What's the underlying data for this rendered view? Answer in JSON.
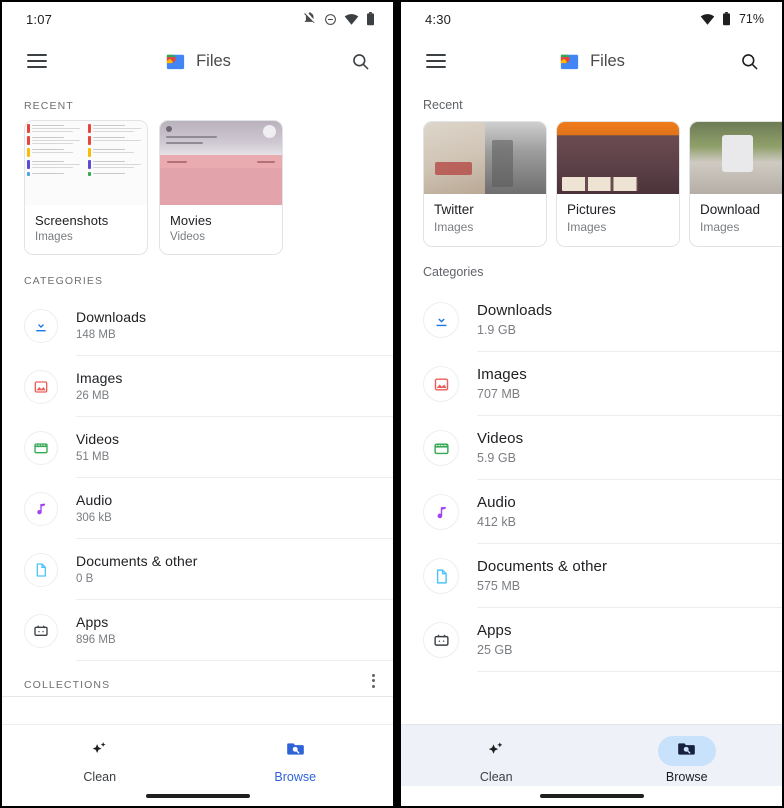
{
  "app": {
    "name": "Files",
    "brand_blue": "#4285f4",
    "accent_blue": "#2f63d8",
    "chip_blue": "#c8e2fb"
  },
  "left_phone": {
    "status": {
      "time": "1:07",
      "icons": [
        "notifications-off-icon",
        "do-not-disturb-icon",
        "wifi-icon",
        "battery-icon"
      ]
    },
    "appbar": {
      "menu": "menu-icon",
      "title": "Files",
      "search": "search-icon"
    },
    "recent": {
      "heading": "RECENT",
      "cards": [
        {
          "title": "Screenshots",
          "subtitle": "Images",
          "thumb": "screenshot-collage"
        },
        {
          "title": "Movies",
          "subtitle": "Videos",
          "thumb": "movie-player"
        }
      ]
    },
    "categories": {
      "heading": "CATEGORIES",
      "items": [
        {
          "icon": "download-icon",
          "color": "#1a73e8",
          "name": "Downloads",
          "size": "148 MB"
        },
        {
          "icon": "image-icon",
          "color": "#ea5f5a",
          "name": "Images",
          "size": "26 MB"
        },
        {
          "icon": "video-icon",
          "color": "#34a853",
          "name": "Videos",
          "size": "51 MB"
        },
        {
          "icon": "audio-icon",
          "color": "#a142f4",
          "name": "Audio",
          "size": "306 kB"
        },
        {
          "icon": "document-icon",
          "color": "#4fc3f7",
          "name": "Documents & other",
          "size": "0 B"
        },
        {
          "icon": "apps-icon",
          "color": "#3c4043",
          "name": "Apps",
          "size": "896 MB"
        }
      ]
    },
    "collections": {
      "heading": "COLLECTIONS",
      "overflow": "more-options-icon"
    },
    "bottom_nav": {
      "items": [
        {
          "icon": "clean-sparkle-icon",
          "label": "Clean",
          "active": false
        },
        {
          "icon": "browse-folder-icon",
          "label": "Browse",
          "active": true
        }
      ]
    }
  },
  "right_phone": {
    "status": {
      "time": "4:30",
      "battery_percent": "71%",
      "icons": [
        "wifi-icon",
        "battery-icon"
      ]
    },
    "appbar": {
      "menu": "menu-icon",
      "title": "Files",
      "search": "search-icon"
    },
    "recent": {
      "heading": "Recent",
      "cards": [
        {
          "title": "Twitter",
          "subtitle": "Images",
          "thumb": "photo-shirt-glasses"
        },
        {
          "title": "Pictures",
          "subtitle": "Images",
          "thumb": "photo-street"
        },
        {
          "title": "Download",
          "subtitle": "Images",
          "thumb": "photo-bicycle"
        }
      ]
    },
    "categories": {
      "heading": "Categories",
      "items": [
        {
          "icon": "download-icon",
          "color": "#1a73e8",
          "name": "Downloads",
          "size": "1.9 GB"
        },
        {
          "icon": "image-icon",
          "color": "#ea5f5a",
          "name": "Images",
          "size": "707 MB"
        },
        {
          "icon": "video-icon",
          "color": "#34a853",
          "name": "Videos",
          "size": "5.9 GB"
        },
        {
          "icon": "audio-icon",
          "color": "#a142f4",
          "name": "Audio",
          "size": "412 kB"
        },
        {
          "icon": "document-icon",
          "color": "#4fc3f7",
          "name": "Documents & other",
          "size": "575 MB"
        },
        {
          "icon": "apps-icon",
          "color": "#3c4043",
          "name": "Apps",
          "size": "25 GB"
        }
      ]
    },
    "bottom_nav": {
      "items": [
        {
          "icon": "clean-sparkle-icon",
          "label": "Clean",
          "active": false
        },
        {
          "icon": "browse-folder-icon",
          "label": "Browse",
          "active": true
        }
      ]
    }
  }
}
